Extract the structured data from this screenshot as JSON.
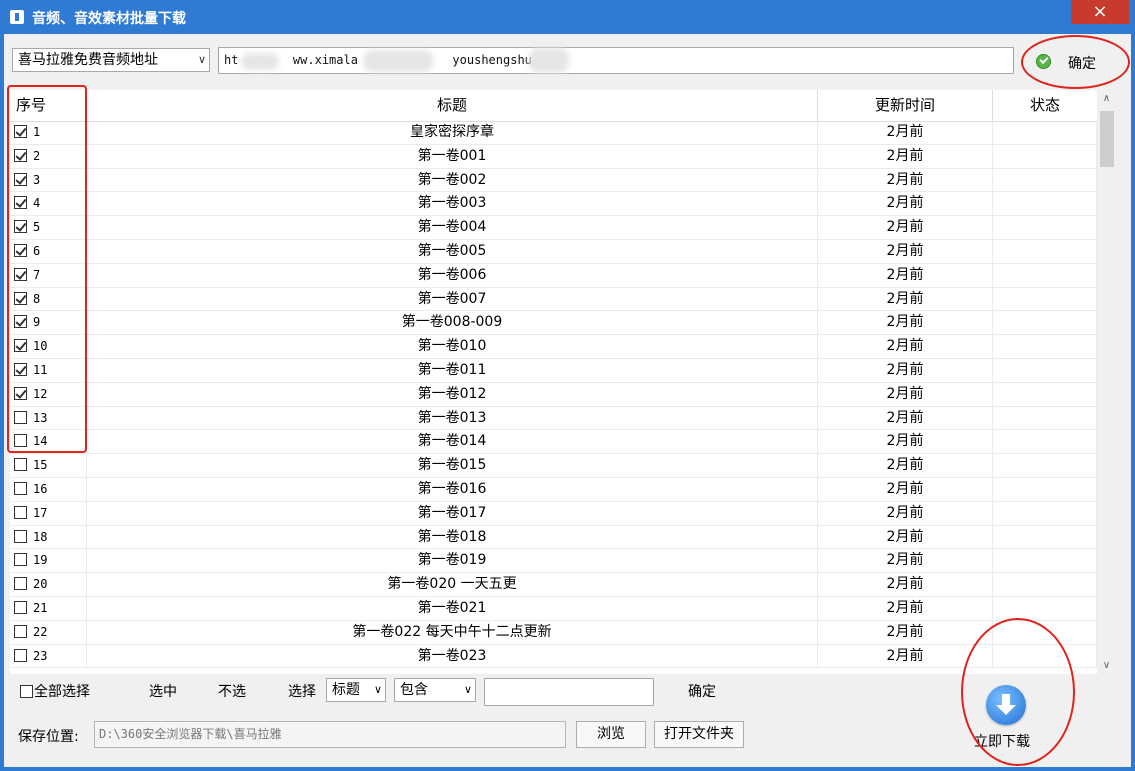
{
  "window": {
    "title": "音频、音效素材批量下载",
    "close_label": "×"
  },
  "toolbar": {
    "source_select": "喜马拉雅免费音频地址",
    "url_parts": [
      "ht",
      "ww.ximala",
      "youshengshu/413"
    ],
    "confirm_label": "确定"
  },
  "table": {
    "headers": {
      "num": "序号",
      "title": "标题",
      "time": "更新时间",
      "status": "状态"
    },
    "rows": [
      {
        "num": "1",
        "checked": true,
        "title": "皇家密探序章",
        "time": "2月前"
      },
      {
        "num": "2",
        "checked": true,
        "title": "第一卷001",
        "time": "2月前"
      },
      {
        "num": "3",
        "checked": true,
        "title": "第一卷002",
        "time": "2月前"
      },
      {
        "num": "4",
        "checked": true,
        "title": "第一卷003",
        "time": "2月前"
      },
      {
        "num": "5",
        "checked": true,
        "title": "第一卷004",
        "time": "2月前"
      },
      {
        "num": "6",
        "checked": true,
        "title": "第一卷005",
        "time": "2月前"
      },
      {
        "num": "7",
        "checked": true,
        "title": "第一卷006",
        "time": "2月前"
      },
      {
        "num": "8",
        "checked": true,
        "title": "第一卷007",
        "time": "2月前"
      },
      {
        "num": "9",
        "checked": true,
        "title": "第一卷008-009",
        "time": "2月前"
      },
      {
        "num": "10",
        "checked": true,
        "title": "第一卷010",
        "time": "2月前"
      },
      {
        "num": "11",
        "checked": true,
        "title": "第一卷011",
        "time": "2月前"
      },
      {
        "num": "12",
        "checked": true,
        "title": "第一卷012",
        "time": "2月前"
      },
      {
        "num": "13",
        "checked": false,
        "title": "第一卷013",
        "time": "2月前"
      },
      {
        "num": "14",
        "checked": false,
        "title": "第一卷014",
        "time": "2月前"
      },
      {
        "num": "15",
        "checked": false,
        "title": "第一卷015",
        "time": "2月前"
      },
      {
        "num": "16",
        "checked": false,
        "title": "第一卷016",
        "time": "2月前"
      },
      {
        "num": "17",
        "checked": false,
        "title": "第一卷017",
        "time": "2月前"
      },
      {
        "num": "18",
        "checked": false,
        "title": "第一卷018",
        "time": "2月前"
      },
      {
        "num": "19",
        "checked": false,
        "title": "第一卷019",
        "time": "2月前"
      },
      {
        "num": "20",
        "checked": false,
        "title": "第一卷020 一天五更",
        "time": "2月前"
      },
      {
        "num": "21",
        "checked": false,
        "title": "第一卷021",
        "time": "2月前"
      },
      {
        "num": "22",
        "checked": false,
        "title": "第一卷022 每天中午十二点更新",
        "time": "2月前"
      },
      {
        "num": "23",
        "checked": false,
        "title": "第一卷023",
        "time": "2月前"
      }
    ]
  },
  "bottom": {
    "select_all_label": "全部选择",
    "select_label": "选中",
    "unselect_label": "不选",
    "choose_label": "选择",
    "field_select": "标题",
    "match_select": "包含",
    "filter_confirm_label": "确定",
    "save_label": "保存位置:",
    "save_path": "D:\\360安全浏览器下载\\喜马拉雅",
    "browse_label": "浏览",
    "open_folder_label": "打开文件夹",
    "download_label": "立即下载"
  },
  "colors": {
    "titlebar": "#2f7ad3",
    "highlight": "#e0241b",
    "close": "#c83a2d"
  }
}
